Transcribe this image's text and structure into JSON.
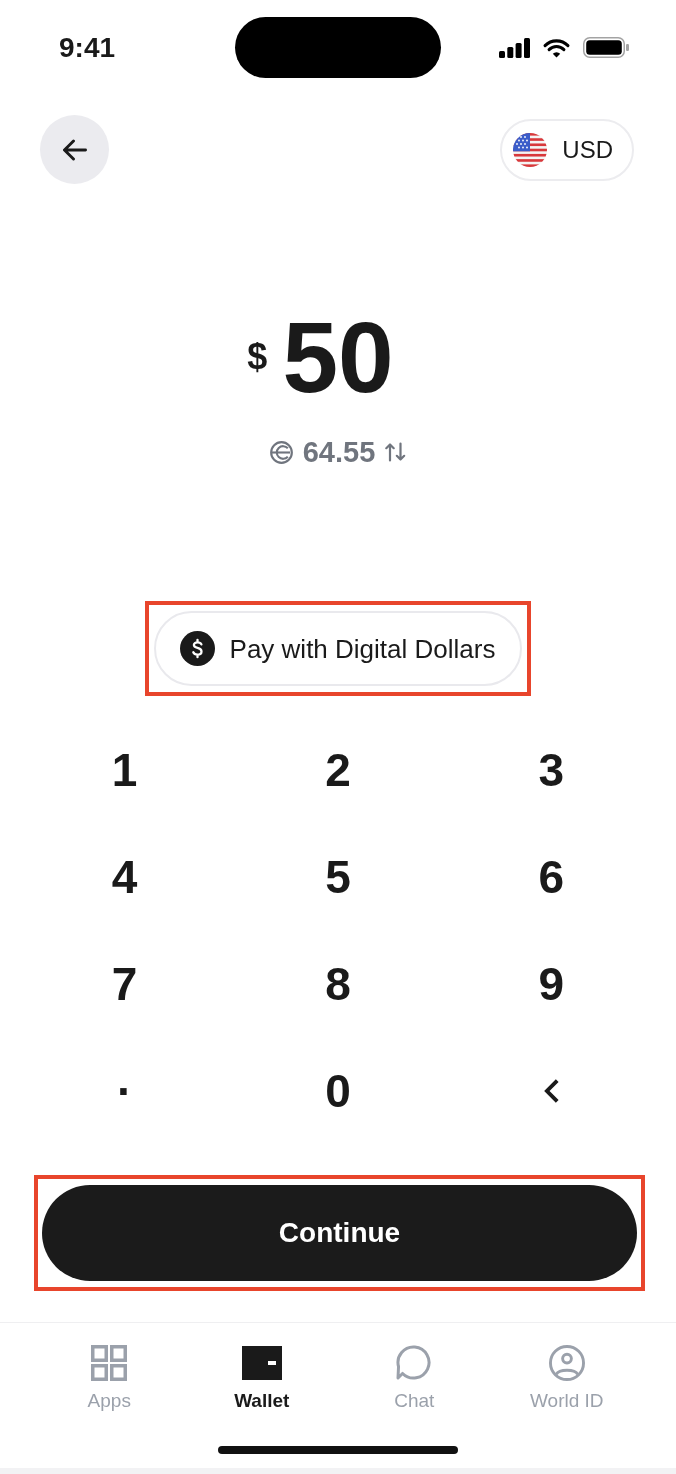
{
  "status_bar": {
    "time": "9:41"
  },
  "header": {
    "currency": "USD"
  },
  "amount": {
    "currency_symbol": "$",
    "value": "50"
  },
  "conversion": {
    "value": "64.55"
  },
  "pay_option": {
    "label": "Pay with Digital Dollars",
    "highlighted": true
  },
  "keypad": [
    {
      "kind": "digit",
      "label": "1"
    },
    {
      "kind": "digit",
      "label": "2"
    },
    {
      "kind": "digit",
      "label": "3"
    },
    {
      "kind": "digit",
      "label": "4"
    },
    {
      "kind": "digit",
      "label": "5"
    },
    {
      "kind": "digit",
      "label": "6"
    },
    {
      "kind": "digit",
      "label": "7"
    },
    {
      "kind": "digit",
      "label": "8"
    },
    {
      "kind": "digit",
      "label": "9"
    },
    {
      "kind": "decimal",
      "label": "·"
    },
    {
      "kind": "digit",
      "label": "0"
    },
    {
      "kind": "backspace"
    }
  ],
  "continue_button": {
    "label": "Continue",
    "highlighted": true
  },
  "tab_bar": [
    {
      "kind": "apps",
      "label": "Apps",
      "selected": false
    },
    {
      "kind": "wallet",
      "label": "Wallet",
      "selected": true
    },
    {
      "kind": "chat",
      "label": "Chat",
      "selected": false
    },
    {
      "kind": "id",
      "label": "World ID",
      "selected": false
    }
  ]
}
